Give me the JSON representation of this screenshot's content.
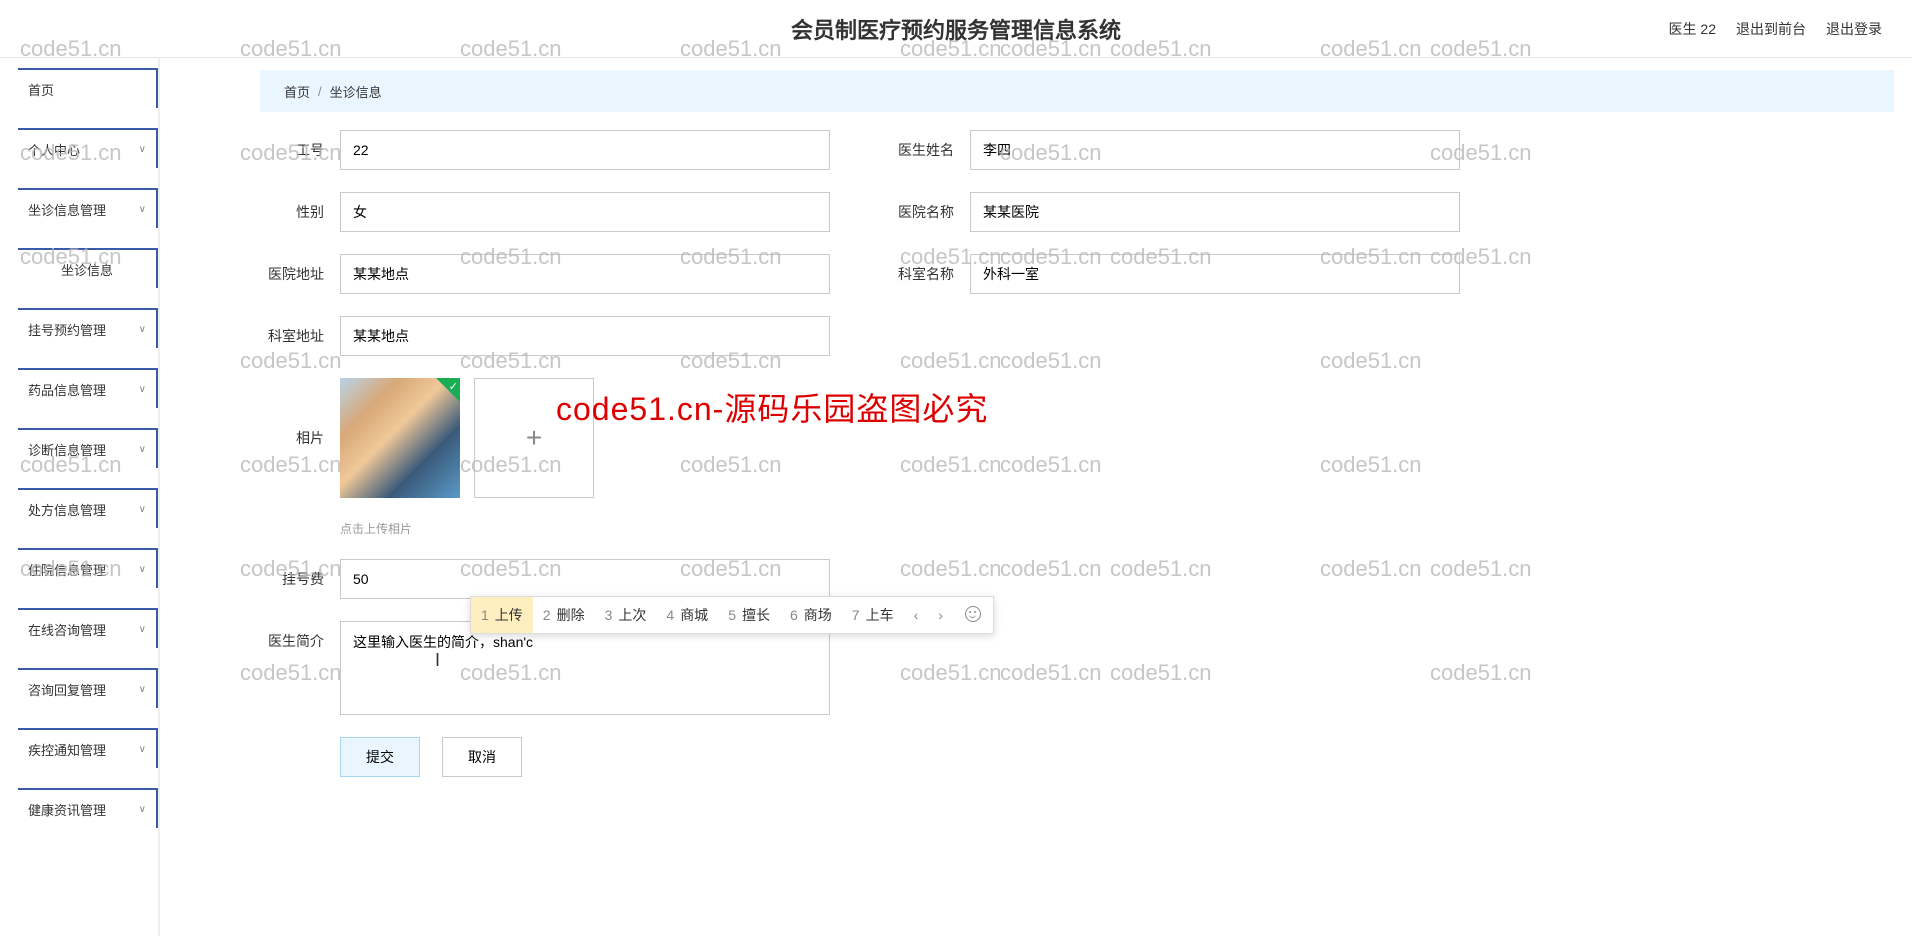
{
  "header": {
    "title": "会员制医疗预约服务管理信息系统",
    "user": "医生 22",
    "back_front": "退出到前台",
    "logout": "退出登录"
  },
  "sidebar": {
    "items": [
      {
        "label": "首页",
        "expandable": false
      },
      {
        "label": "个人中心",
        "expandable": true
      },
      {
        "label": "坐诊信息管理",
        "expandable": true
      },
      {
        "label": "坐诊信息",
        "expandable": false,
        "active": true
      },
      {
        "label": "挂号预约管理",
        "expandable": true
      },
      {
        "label": "药品信息管理",
        "expandable": true
      },
      {
        "label": "诊断信息管理",
        "expandable": true
      },
      {
        "label": "处方信息管理",
        "expandable": true
      },
      {
        "label": "住院信息管理",
        "expandable": true
      },
      {
        "label": "在线咨询管理",
        "expandable": true
      },
      {
        "label": "咨询回复管理",
        "expandable": true
      },
      {
        "label": "疾控通知管理",
        "expandable": true
      },
      {
        "label": "健康资讯管理",
        "expandable": true
      }
    ]
  },
  "breadcrumb": {
    "home": "首页",
    "sep": "/",
    "current": "坐诊信息"
  },
  "form": {
    "labels": {
      "emp_id": "工号",
      "doctor_name": "医生姓名",
      "gender": "性别",
      "hospital_name": "医院名称",
      "hospital_addr": "医院地址",
      "dept_name": "科室名称",
      "dept_addr": "科室地址",
      "photo": "相片",
      "reg_fee": "挂号费",
      "doctor_intro": "医生简介"
    },
    "values": {
      "emp_id": "22",
      "doctor_name": "李四",
      "gender": "女",
      "hospital_name": "某某医院",
      "hospital_addr": "某某地点",
      "dept_name": "外科一室",
      "dept_addr": "某某地点",
      "reg_fee": "50",
      "doctor_intro": "这里输入医生的简介，shan'c"
    },
    "photo_hint": "点击上传相片",
    "submit": "提交",
    "cancel": "取消"
  },
  "ime": {
    "candidates": [
      {
        "n": "1",
        "t": "上传"
      },
      {
        "n": "2",
        "t": "删除"
      },
      {
        "n": "3",
        "t": "上次"
      },
      {
        "n": "4",
        "t": "商城"
      },
      {
        "n": "5",
        "t": "擅长"
      },
      {
        "n": "6",
        "t": "商场"
      },
      {
        "n": "7",
        "t": "上车"
      }
    ],
    "prev": "‹",
    "next": "›"
  },
  "watermark": {
    "text": "code51.cn",
    "big": "code51.cn-源码乐园盗图必究"
  }
}
